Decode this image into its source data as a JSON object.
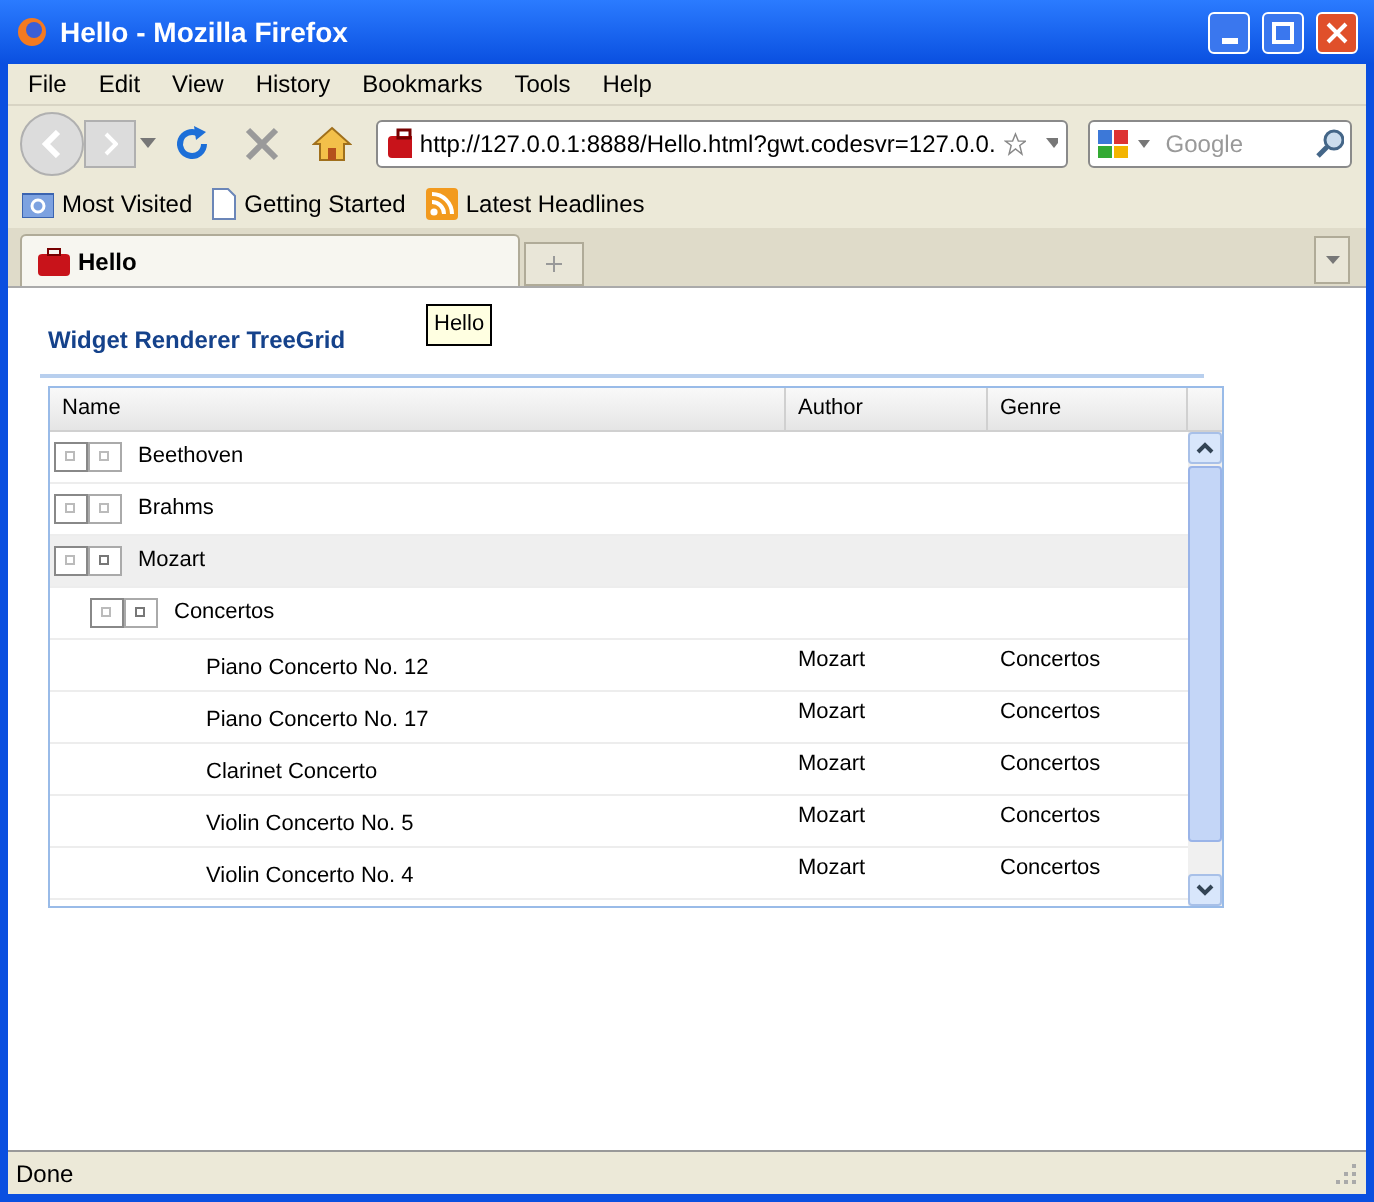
{
  "window": {
    "title": "Hello - Mozilla Firefox"
  },
  "menu": [
    "File",
    "Edit",
    "View",
    "History",
    "Bookmarks",
    "Tools",
    "Help"
  ],
  "address": {
    "value": "http://127.0.0.1:8888/Hello.html?gwt.codesvr=127.0.0."
  },
  "search": {
    "placeholder": "Google"
  },
  "bookmarks": [
    "Most Visited",
    "Getting Started",
    "Latest Headlines"
  ],
  "tabs": [
    {
      "label": "Hello",
      "selected": true
    }
  ],
  "page": {
    "heading": "Widget Renderer TreeGrid",
    "tooltip": "Hello"
  },
  "table": {
    "columns": [
      "Name",
      "Author",
      "Genre"
    ],
    "rows": [
      {
        "name": "Beethoven",
        "selected": false,
        "expanded": false
      },
      {
        "name": "Brahms",
        "selected": false,
        "expanded": false
      },
      {
        "name": "Mozart",
        "selected": true,
        "expanded": true,
        "children": [
          {
            "name": "Concertos",
            "selected": false,
            "expanded": true,
            "children": [
              {
                "name": "Piano Concerto No. 12",
                "author": "Mozart",
                "genre": "Concertos",
                "selected": false
              },
              {
                "name": "Piano Concerto No. 17",
                "author": "Mozart",
                "genre": "Concertos",
                "selected": false
              },
              {
                "name": "Clarinet Concerto",
                "author": "Mozart",
                "genre": "Concertos",
                "selected": false
              },
              {
                "name": "Violin Concerto No. 5",
                "author": "Mozart",
                "genre": "Concertos",
                "selected": false
              },
              {
                "name": "Violin Concerto No. 4",
                "author": "Mozart",
                "genre": "Concertos",
                "selected": false
              }
            ]
          }
        ]
      }
    ]
  },
  "status_bar": "Done"
}
